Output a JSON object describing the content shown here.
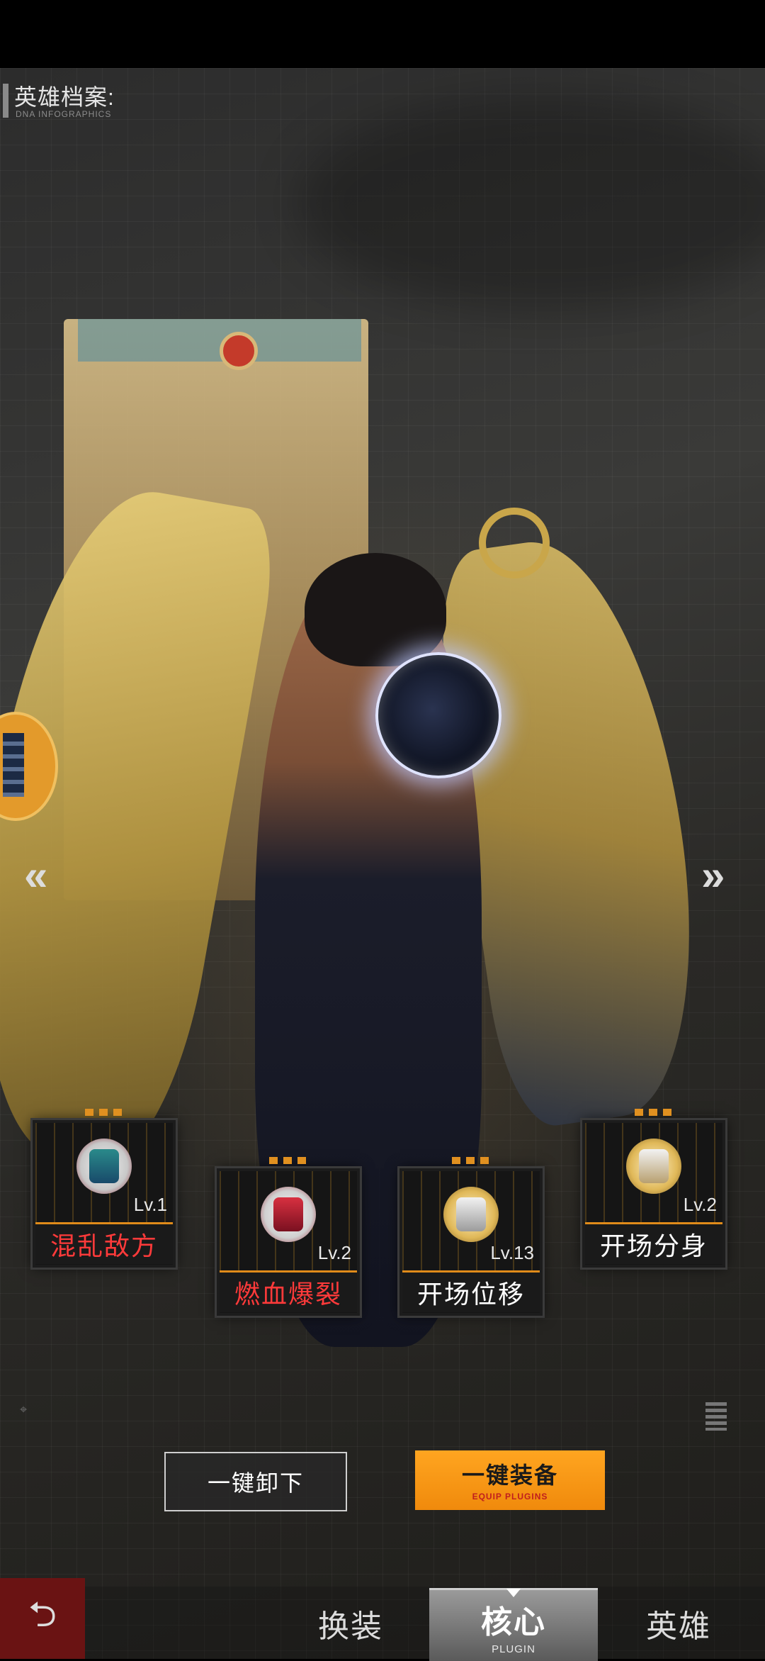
{
  "header": {
    "title": "英雄档案:",
    "subtitle": "DNA INFOGRAPHICS"
  },
  "plugins": [
    {
      "name": "混乱敌方",
      "level": "Lv.1",
      "color": "#ff3a3a",
      "icon": "chaos-emblem-icon"
    },
    {
      "name": "燃血爆裂",
      "level": "Lv.2",
      "color": "#ff3a3a",
      "icon": "blood-burst-emblem-icon"
    },
    {
      "name": "开场位移",
      "level": "Lv.13",
      "color": "#ffffff",
      "icon": "opening-dash-emblem-icon"
    },
    {
      "name": "开场分身",
      "level": "Lv.2",
      "color": "#ffffff",
      "icon": "opening-clone-emblem-icon"
    }
  ],
  "buttons": {
    "unequip_all": "一键卸下",
    "equip_all": "一键装备",
    "equip_all_sub": "EQUIP PLUGINS"
  },
  "nav": {
    "prev": "«",
    "next": "»",
    "back": "⮌"
  },
  "tabs": {
    "outfit": "换装",
    "core": "核心",
    "core_sub": "PLUGIN",
    "hero": "英雄"
  },
  "colors": {
    "accent": "#f59a14",
    "danger_text": "#ff3a3a"
  }
}
